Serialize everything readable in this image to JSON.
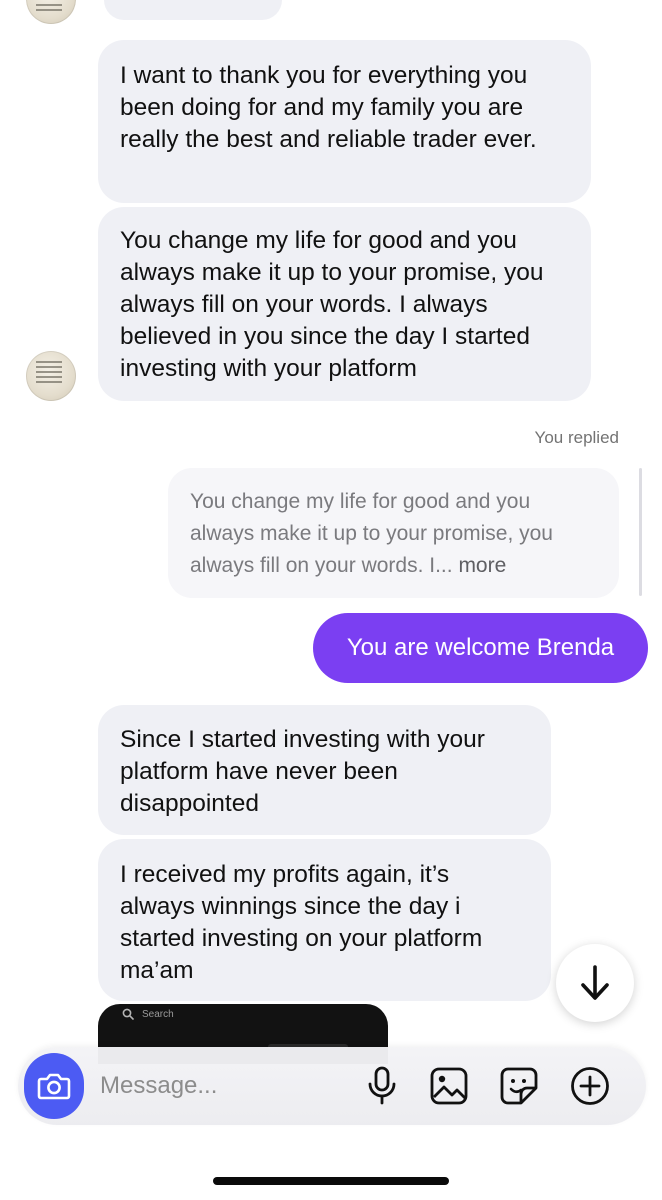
{
  "conversation": {
    "incoming": [
      {
        "text": "I want to thank you for everything you been doing for and my family you are really the best and reliable trader ever."
      },
      {
        "text": "You change my life for good and you always make it up to your promise, you always fill on your words. I always believed in you since the day I started investing with your platform"
      },
      {
        "text": "Since I started investing with your platform have never been disappointed"
      },
      {
        "text": "I received my profits again, it’s always winnings since the day i started investing on your platform ma’am"
      }
    ],
    "replied_label": "You replied",
    "quoted_preview": "You change my life for good and you always make it up to your promise, you always fill on your words. I...",
    "quoted_more": "more",
    "outgoing": [
      {
        "text": "You are welcome Brenda"
      }
    ],
    "media_preview": {
      "search_text": "Search"
    }
  },
  "composer": {
    "placeholder": "Message...",
    "value": ""
  },
  "icons": {
    "camera": "camera-icon",
    "mic": "microphone-icon",
    "gallery": "image-icon",
    "sticker": "sticker-icon",
    "plus": "plus-circle-icon",
    "scroll_down": "arrow-down-icon"
  },
  "colors": {
    "accent_purple": "#7b3ff2",
    "camera_blue": "#4c5bf3",
    "incoming_bubble": "#eff0f5",
    "muted_text": "#737373"
  }
}
